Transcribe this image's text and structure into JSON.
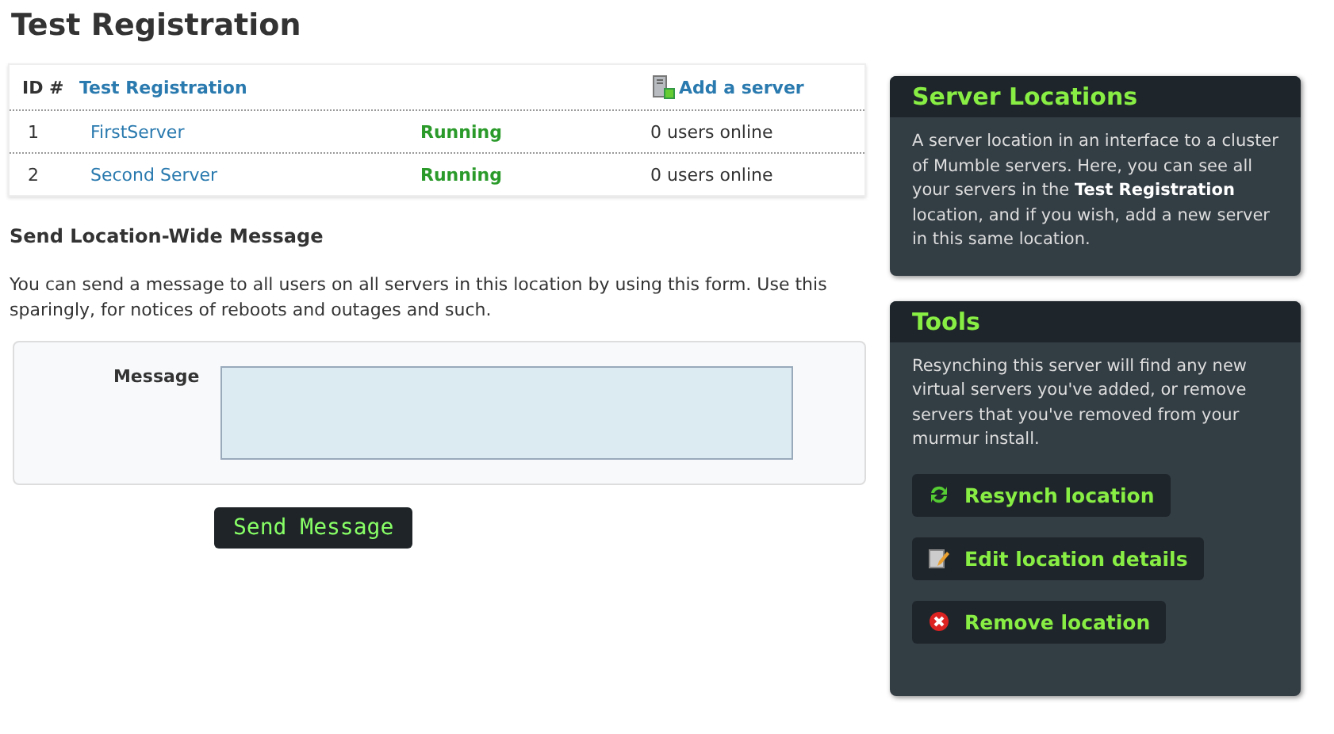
{
  "page_title": "Test Registration",
  "table": {
    "columns": [
      "ID #",
      "Test Registration"
    ],
    "add_link": "Add a server",
    "rows": [
      {
        "id": "1",
        "name": "FirstServer",
        "status": "Running",
        "users": "0 users online"
      },
      {
        "id": "2",
        "name": "Second Server",
        "status": "Running",
        "users": "0 users online"
      }
    ]
  },
  "message_section": {
    "heading": "Send Location-Wide Message",
    "description": "You can send a message to all users on all servers in this location by using this form. Use this sparingly, for notices of reboots and outages and such.",
    "field_label": "Message",
    "button": "Send Message"
  },
  "sidebar": [
    {
      "title": "Server Locations",
      "text": "A server location in an interface to a cluster of Mumble servers. Here, you can see all your servers in the **Test Registration** location, and if you wish, add a new server in this same location."
    },
    {
      "title": "Tools",
      "text": "Resynching this server will find any new virtual servers you've added, or remove servers that you've removed from your murmur install.",
      "buttons": [
        {
          "kind": "resynch",
          "label": "Resynch location"
        },
        {
          "kind": "edit",
          "label": "Edit location details"
        },
        {
          "kind": "remove",
          "label": "Remove location"
        }
      ]
    }
  ]
}
